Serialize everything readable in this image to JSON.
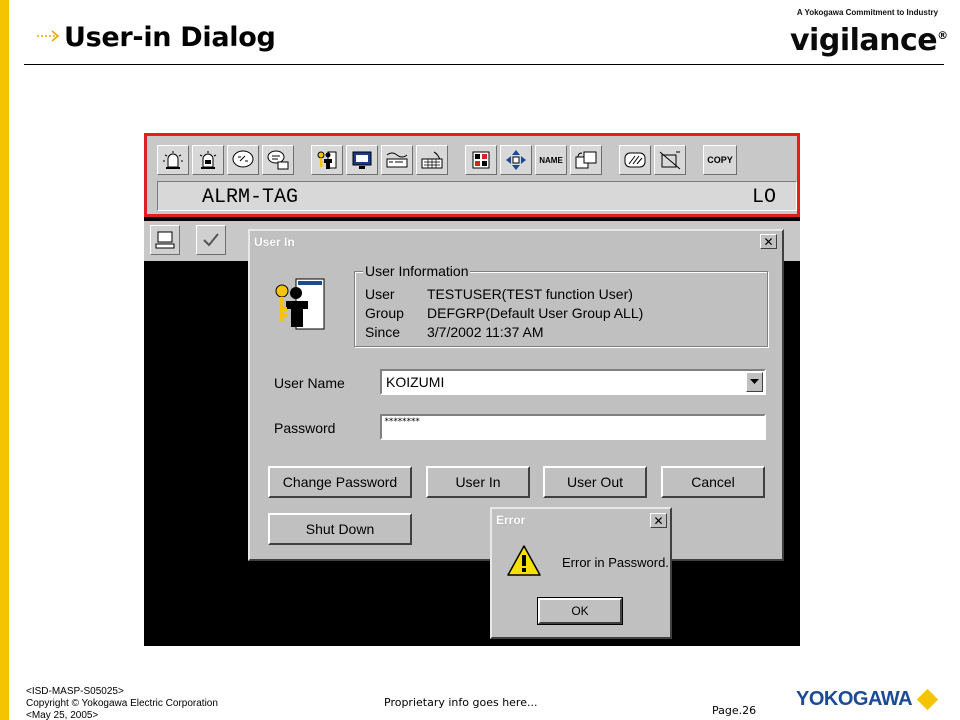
{
  "slide": {
    "title": "User-in Dialog",
    "logo_tagline": "A Yokogawa Commitment to Industry",
    "logo_word": "vigilance",
    "logo_mark": "®"
  },
  "footer": {
    "doc_id": "<ISD-MASP-S05025>",
    "copyright": "Copyright © Yokogawa Electric Corporation",
    "date": "<May 25, 2005>",
    "proprietary": "Proprietary info goes here...",
    "page": "Page.26",
    "company_logo": "YOKOGAWA"
  },
  "toolbar": {
    "icons": [
      "alarm-lamp-icon",
      "alarm-lamp-acknowledge-icon",
      "message-icon",
      "operator-guide-icon",
      "user-in-icon",
      "screen-display-icon",
      "recorder-icon",
      "keyboard-icon",
      "process-report-icon",
      "navigation-icon",
      "name-input",
      "window-call-icon",
      "clear-icon",
      "preset-icon",
      "copy"
    ],
    "name_label": "NAME",
    "copy_label": "COPY"
  },
  "alarm_field": {
    "tag": "ALRM-TAG",
    "level": "LO"
  },
  "user_in_dialog": {
    "title": "User In",
    "group_title": "User Information",
    "info": [
      {
        "label": "User",
        "value": "TESTUSER(TEST function User)"
      },
      {
        "label": "Group",
        "value": "DEFGRP(Default User Group ALL)"
      },
      {
        "label": "Since",
        "value": "3/7/2002 11:37 AM"
      }
    ],
    "user_name_label": "User Name",
    "user_name_value": "KOIZUMI",
    "password_label": "Password",
    "password_value": "********",
    "buttons": {
      "change_password": "Change Password",
      "user_in": "User In",
      "user_out": "User Out",
      "cancel": "Cancel",
      "shut_down": "Shut Down"
    }
  },
  "error_dialog": {
    "title": "Error",
    "message": "Error in Password.",
    "ok": "OK"
  },
  "colors": {
    "accent_bar": "#f5c400",
    "panel_border": "#e02020",
    "brand_blue": "#1b4a96"
  }
}
